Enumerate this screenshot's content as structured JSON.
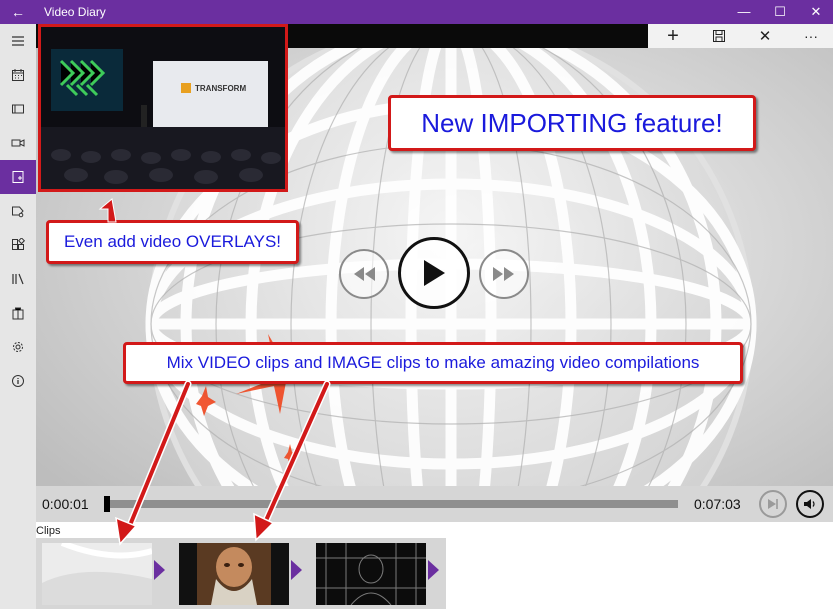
{
  "window": {
    "title": "Video Diary",
    "back_icon": "←",
    "minimize_icon": "—",
    "maximize_icon": "☐",
    "close_icon": "✕"
  },
  "sidebar": {
    "items": [
      {
        "icon": "hamburger-menu-icon"
      },
      {
        "icon": "calendar-icon"
      },
      {
        "icon": "video-frame-icon"
      },
      {
        "icon": "camera-icon"
      },
      {
        "icon": "import-icon",
        "active": true
      },
      {
        "icon": "tag-icon"
      },
      {
        "icon": "apps-icon"
      },
      {
        "icon": "library-icon"
      },
      {
        "icon": "store-icon"
      },
      {
        "icon": "settings-gear-icon"
      },
      {
        "icon": "info-icon"
      }
    ]
  },
  "commandbar": {
    "add_icon": "+",
    "save_icon": "save-icon",
    "discard_icon": "✕",
    "more_icon": "···"
  },
  "overlay_clip": {
    "screen_text": "TRANSFORM"
  },
  "callouts": {
    "importing": "New IMPORTING feature!",
    "overlays": "Even add video OVERLAYS!",
    "mix": "Mix VIDEO clips and IMAGE clips to make amazing video compilations"
  },
  "player": {
    "current_time": "0:00:01",
    "total_time": "0:07:03",
    "progress": 0.002
  },
  "clips": {
    "label": "Clips",
    "items": [
      {
        "kind": "image-clip"
      },
      {
        "kind": "video-clip"
      },
      {
        "kind": "video-clip"
      }
    ]
  },
  "colors": {
    "accent": "#6b2fa0",
    "callout_border": "#d21919",
    "callout_text": "#1a1adc"
  }
}
